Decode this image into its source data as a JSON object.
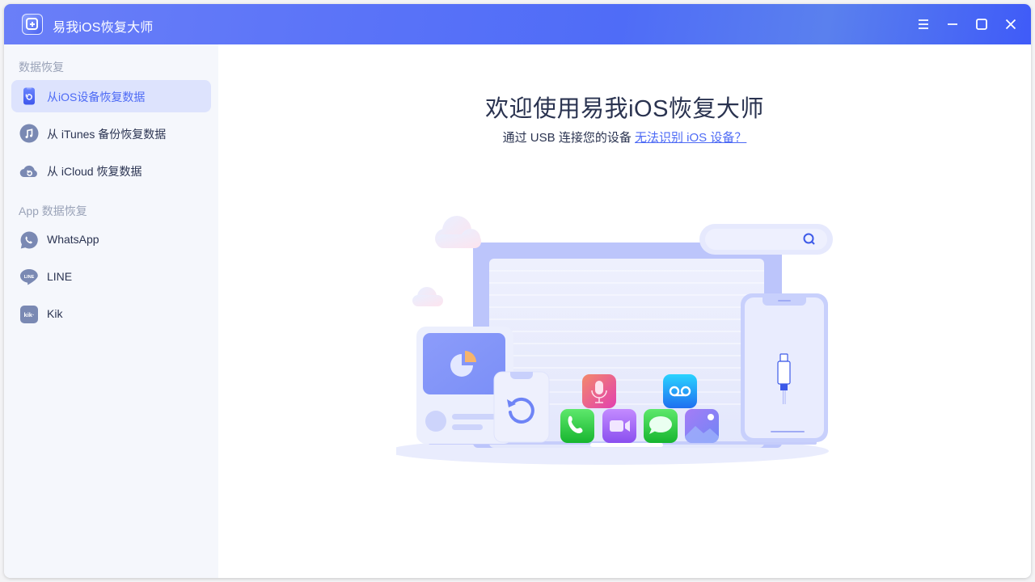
{
  "window": {
    "title": "易我iOS恢复大师",
    "controls": [
      "menu",
      "minimize",
      "maximize",
      "close"
    ]
  },
  "sidebar": {
    "sections": [
      {
        "label": "数据恢复",
        "items": [
          {
            "label": "从iOS设备恢复数据",
            "icon": "ios-device-icon",
            "active": true
          },
          {
            "label": "从 iTunes 备份恢复数据",
            "icon": "itunes-music-icon",
            "active": false
          },
          {
            "label": "从 iCloud 恢复数据",
            "icon": "icloud-icon",
            "active": false
          }
        ]
      },
      {
        "label": "App 数据恢复",
        "items": [
          {
            "label": "WhatsApp",
            "icon": "whatsapp-icon",
            "active": false
          },
          {
            "label": "LINE",
            "icon": "line-icon",
            "active": false
          },
          {
            "label": "Kik",
            "icon": "kik-icon",
            "active": false
          }
        ]
      }
    ]
  },
  "main": {
    "title": "欢迎使用易我iOS恢复大师",
    "subtitle": "通过 USB 连接您的设备",
    "help_link": "无法识别 iOS 设备？",
    "illustration": {
      "app_icons": [
        "voice-memo",
        "voicemail",
        "phone",
        "facetime",
        "messages",
        "photos"
      ],
      "line_icon_text": "LINE",
      "kik_icon_text": "kik·"
    }
  },
  "colors": {
    "accent": "#4d6af5",
    "titlebar": "#5a73f8",
    "sidebar_bg": "#f5f7fc",
    "active_item_bg": "#dde3fd",
    "icon_gray": "#7a89b3"
  }
}
